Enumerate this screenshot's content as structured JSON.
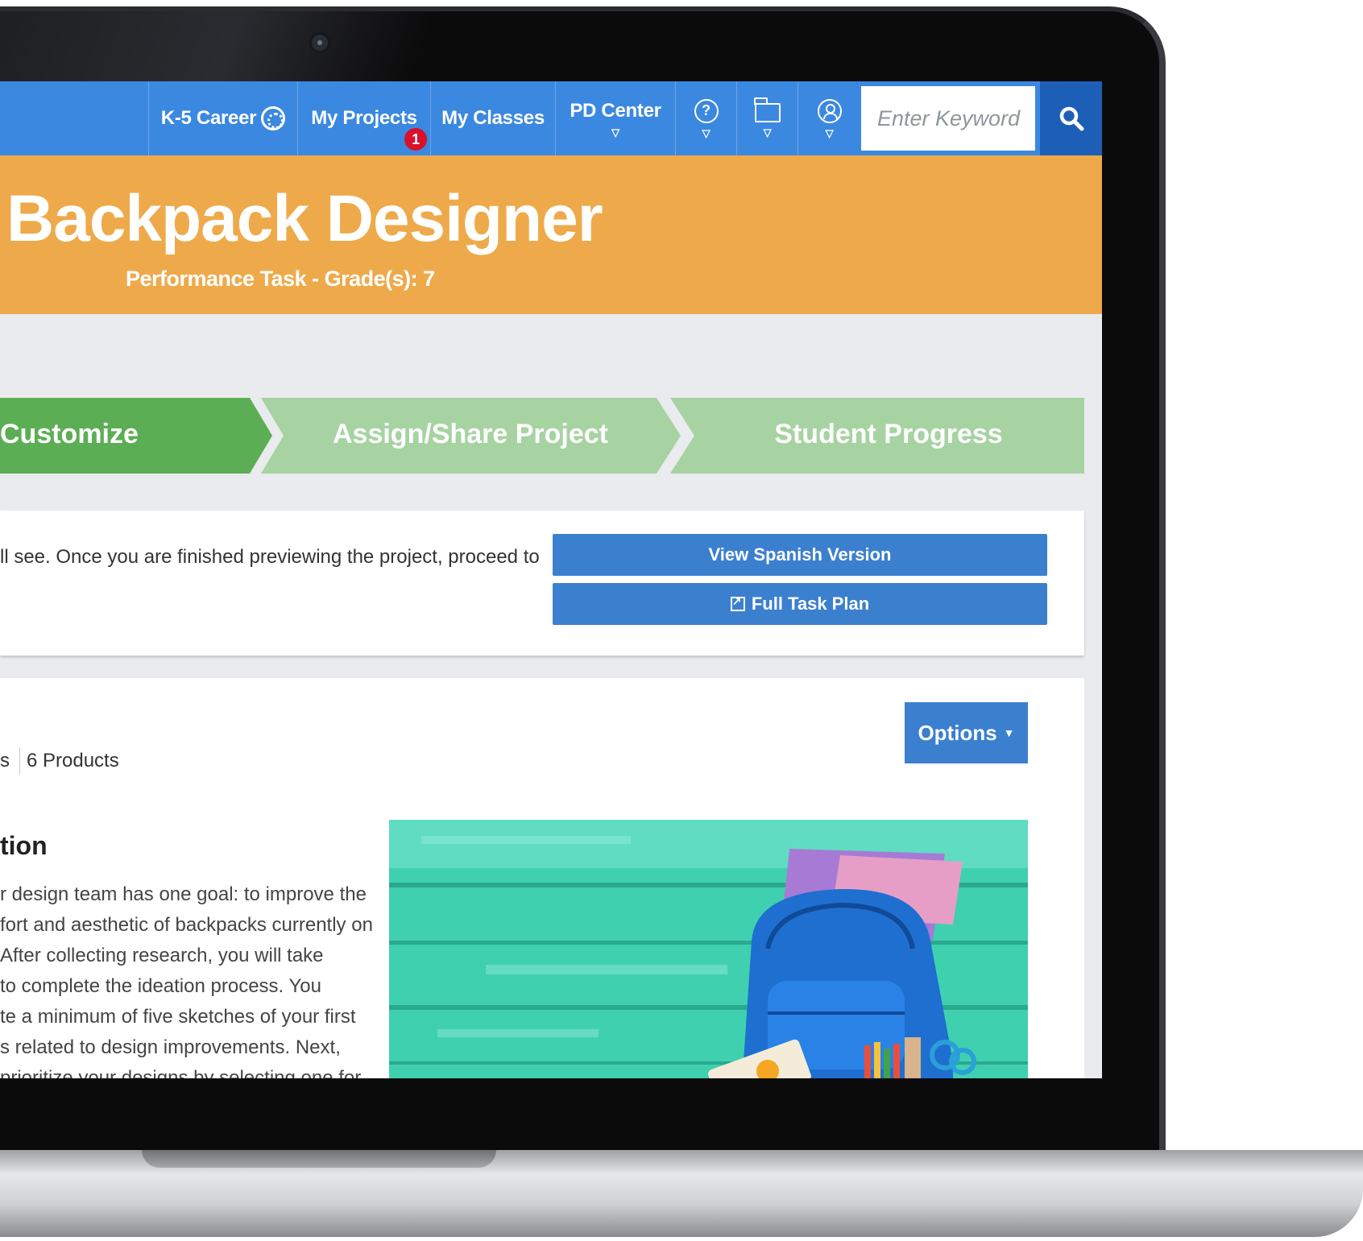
{
  "nav": {
    "k5_label": "K-5 Career",
    "my_projects_label": "My Projects",
    "my_projects_badge": "1",
    "my_classes_label": "My Classes",
    "pd_center_label": "PD Center",
    "search_placeholder": "Enter Keyword",
    "icons": [
      "help-icon",
      "folder-icon",
      "user-icon",
      "search-icon"
    ]
  },
  "banner": {
    "title": "Backpack Designer",
    "subtitle": "Performance Task - Grade(s): 7"
  },
  "steps": [
    {
      "label": "Customize",
      "state": "active"
    },
    {
      "label": "Assign/Share Project",
      "state": "inactive"
    },
    {
      "label": "Student Progress",
      "state": "inactive"
    }
  ],
  "info": {
    "text": "ll see. Once you are finished previewing the project, proceed to",
    "spanish_button": "View Spanish Version",
    "task_plan_button": "Full Task Plan"
  },
  "content": {
    "options_label": "Options",
    "meta_left": "s",
    "meta_products": "6 Products",
    "section_title": "tion",
    "description_lines": [
      "r design team has one goal: to improve the",
      "fort and aesthetic of backpacks currently on",
      " After collecting research, you will take",
      "to complete the ideation process. You",
      "te a minimum of five sketches of your first",
      "s related to design improvements. Next,",
      "prioritize your designs by selecting one for"
    ]
  },
  "colors": {
    "nav_blue": "#3b88e0",
    "search_btn": "#1d5fb6",
    "banner_orange": "#eeaa4a",
    "step_active": "#5cae54",
    "step_inactive": "#a6d3a1",
    "button_blue": "#3b7fcf",
    "badge_red": "#d8102a"
  }
}
